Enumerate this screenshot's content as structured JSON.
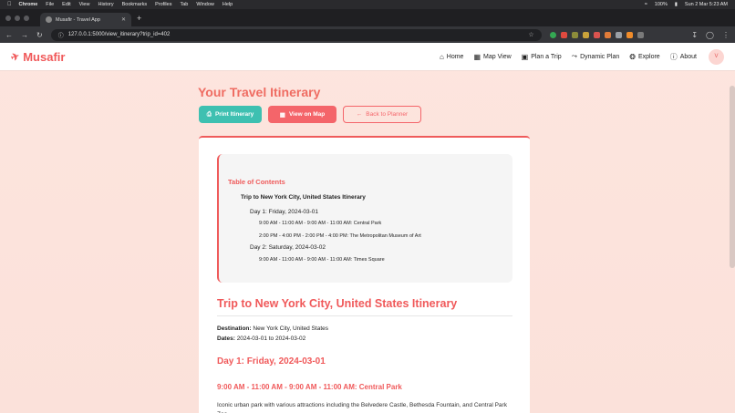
{
  "os_menu": {
    "app": "Chrome",
    "items": [
      "File",
      "Edit",
      "View",
      "History",
      "Bookmarks",
      "Profiles",
      "Tab",
      "Window",
      "Help"
    ],
    "battery": "100%",
    "clock": "Sun 2 Mar  5:23 AM"
  },
  "browser": {
    "tab_title": "Musafir - Travel App",
    "url": "127.0.0.1:5000/view_itinerary?trip_id=402"
  },
  "nav": {
    "brand": "Musafir",
    "links": {
      "home": "Home",
      "map_view": "Map View",
      "plan_trip": "Plan a Trip",
      "dynamic_plan": "Dynamic Plan",
      "explore": "Explore",
      "about": "About"
    },
    "avatar": "V"
  },
  "page": {
    "title": "Your Travel Itinerary",
    "buttons": {
      "print": "Print Itinerary",
      "map": "View on Map",
      "back": "Back to Planner"
    }
  },
  "toc": {
    "heading": "Table of Contents",
    "trip": "Trip to New York City, United States Itinerary",
    "day1": "Day 1: Friday, 2024-03-01",
    "day1_items": [
      "9:00 AM - 11:00 AM - 9:00 AM - 11:00 AM: Central Park",
      "2:00 PM - 4:00 PM - 2:00 PM - 4:00 PM: The Metropolitan Museum of Art"
    ],
    "day2": "Day 2: Saturday, 2024-03-02",
    "day2_items": [
      "9:00 AM - 11:00 AM - 9:00 AM - 11:00 AM: Times Square"
    ]
  },
  "itinerary": {
    "heading": "Trip to New York City, United States Itinerary",
    "destination_label": "Destination:",
    "destination": "New York City, United States",
    "dates_label": "Dates:",
    "dates": "2024-03-01 to 2024-03-02",
    "day1_heading": "Day 1: Friday, 2024-03-01",
    "activity1_heading": "9:00 AM - 11:00 AM - 9:00 AM - 11:00 AM: Central Park",
    "activity1_desc": "Iconic urban park with various attractions including the Belvedere Castle, Bethesda Fountain, and Central Park Zoo."
  }
}
